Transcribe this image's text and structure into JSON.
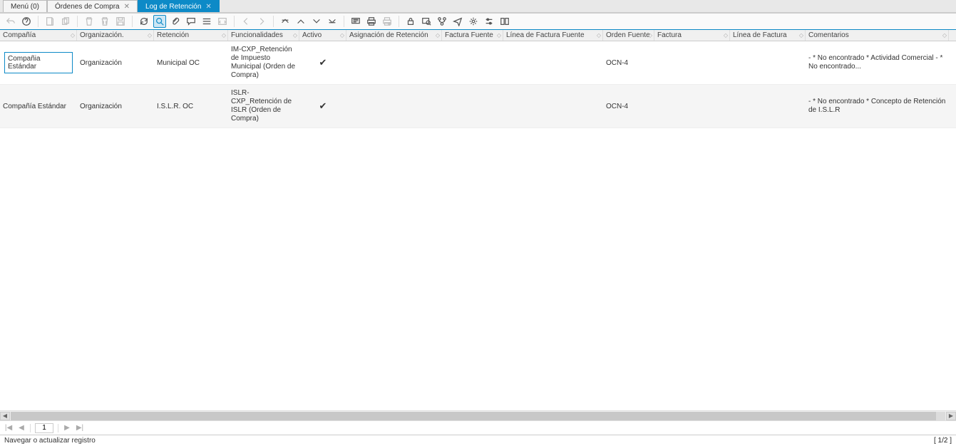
{
  "tabs": [
    {
      "label": "Menú (0)",
      "closable": false,
      "active": false
    },
    {
      "label": "Órdenes de Compra",
      "closable": true,
      "active": false
    },
    {
      "label": "Log de Retención",
      "closable": true,
      "active": true
    }
  ],
  "toolbar_icons": [
    "undo",
    "help",
    "",
    "new",
    "copy",
    "",
    "delete",
    "delete-sel",
    "save",
    "",
    "refresh",
    "search",
    "attach",
    "chat",
    "list",
    "code",
    "",
    "prev",
    "next",
    "",
    "up-first",
    "up",
    "down",
    "down-last",
    "",
    "detail",
    "print",
    "print-disabled",
    "",
    "lock",
    "zoom",
    "flow",
    "send",
    "gear",
    "slider",
    "toggle"
  ],
  "columns": [
    "Compañía",
    "Organización.",
    "Retención",
    "Funcionalidades",
    "Activo",
    "Asignación de Retención",
    "Factura Fuente",
    "Línea de Factura Fuente",
    "Orden Fuente",
    "Factura",
    "Línea de Factura",
    "Comentarios"
  ],
  "rows": [
    {
      "compania": "Compañia Estándar",
      "organizacion": "Organización",
      "retencion": "Municipal OC",
      "funcionalidades": "IM-CXP_Retención de Impuesto Municipal (Orden de Compra)",
      "activo": true,
      "asignacion": "",
      "factura_fuente": "",
      "linea_factura_fuente": "",
      "orden_fuente": "OCN-4",
      "factura": "",
      "linea_factura": "",
      "comentarios": "- * No encontrado * Actividad Comercial - * No encontrado...",
      "editing": true
    },
    {
      "compania": "Compañía Estándar",
      "organizacion": "Organización",
      "retencion": "I.S.L.R. OC",
      "funcionalidades": "ISLR-CXP_Retención de ISLR (Orden de Compra)",
      "activo": true,
      "asignacion": "",
      "factura_fuente": "",
      "linea_factura_fuente": "",
      "orden_fuente": "OCN-4",
      "factura": "",
      "linea_factura": "",
      "comentarios": "- * No encontrado * Concepto de Retención de I.S.L.R",
      "editing": false
    }
  ],
  "pager": {
    "page": "1"
  },
  "status": {
    "left": "Navegar o actualizar registro",
    "right": "[ 1/2 ]"
  }
}
